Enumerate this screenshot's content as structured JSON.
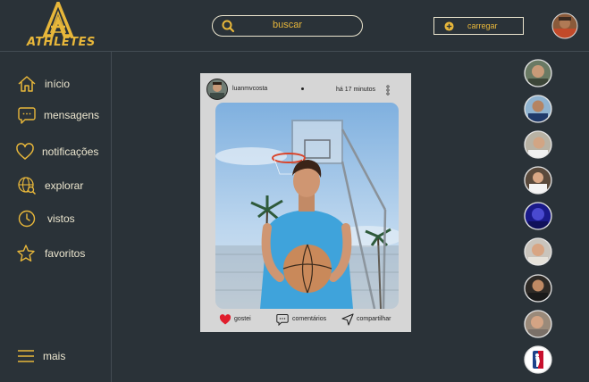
{
  "brand": {
    "name": "ATHLETES"
  },
  "header": {
    "search_placeholder": "buscar",
    "upload_label": "carregar"
  },
  "sidebar": {
    "items": [
      {
        "label": "início",
        "icon": "home-icon"
      },
      {
        "label": "mensagens",
        "icon": "chat-icon"
      },
      {
        "label": "notificações",
        "icon": "heart-icon"
      },
      {
        "label": "explorar",
        "icon": "globe-search-icon"
      },
      {
        "label": "vistos",
        "icon": "clock-icon"
      },
      {
        "label": "favoritos",
        "icon": "star-icon"
      }
    ],
    "more_label": "mais"
  },
  "post": {
    "username": "luanmvcosta",
    "time": "há 17 minutos",
    "actions": {
      "like": "gostei",
      "comments": "comentários",
      "share": "compartilhar"
    }
  },
  "colors": {
    "background": "#2a3238",
    "accent": "#e8b73a",
    "text": "#ece6cf",
    "card": "#d6d6d6",
    "like": "#e01e2d"
  }
}
